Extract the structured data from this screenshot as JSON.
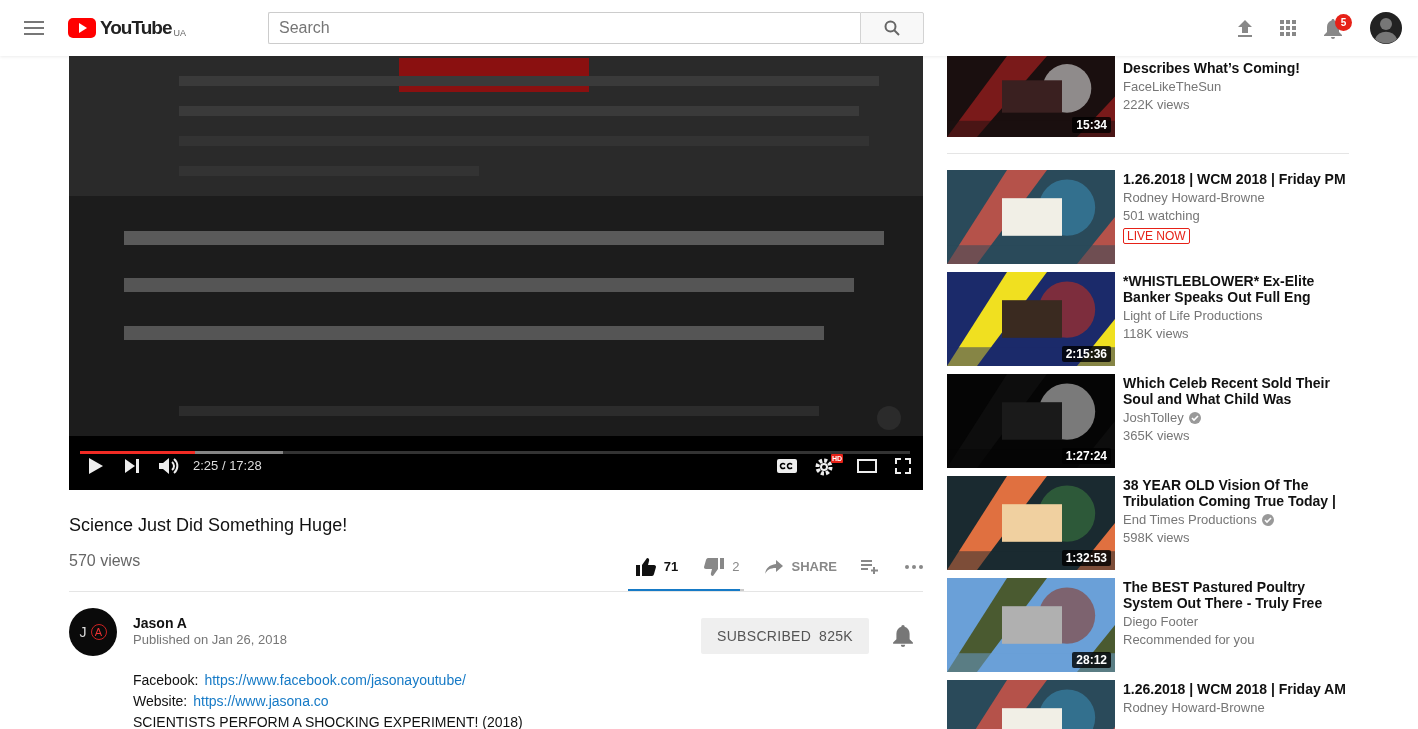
{
  "header": {
    "logo": "YouTube",
    "region": "UA",
    "search": {
      "placeholder": "Search"
    },
    "notifications": "5"
  },
  "player": {
    "progress": {
      "level": 0.139
    },
    "buffered": {
      "level": 0.245
    },
    "time": "2:25 / 17:28",
    "hd_badge": "HD"
  },
  "video": {
    "title": "Science Just Did Something Huge!",
    "views": "570 views",
    "likes": "71",
    "dislikes": "2",
    "share": "SHARE",
    "sentiment": {
      "level": 0.97
    }
  },
  "channel": {
    "avatar_letters": [
      "J",
      "A"
    ],
    "name": "Jason A",
    "published": "Published on Jan 26, 2018",
    "subscribe_label": "SUBSCRIBED",
    "subscribers": "825K",
    "subscribed": true
  },
  "description": [
    {
      "label": "Facebook:",
      "link": "https://www.facebook.com/jasonayoutube/"
    },
    {
      "label": "Website:",
      "link": "https://www.jasona.co"
    },
    {
      "text": "SCIENTISTS PERFORM A SHOCKING EXPERIMENT! (2018)"
    }
  ],
  "sidebar": {
    "items": [
      {
        "title": "Describes What’s Coming!",
        "channel": "FaceLikeTheSun",
        "verified": false,
        "meta": "222K views",
        "duration": "15:34",
        "live": false
      },
      {
        "title": "1.26.2018 | WCM 2018 | Friday PM",
        "channel": "Rodney Howard-Browne",
        "verified": false,
        "meta": "501 watching",
        "live": true,
        "live_label": "LIVE NOW"
      },
      {
        "title": "*WHISTLEBLOWER* Ex-Elite Banker Speaks Out Full Eng",
        "channel": "Light of Life Productions",
        "verified": false,
        "meta": "118K views",
        "duration": "2:15:36",
        "live": false
      },
      {
        "title": "Which Celeb Recent Sold Their Soul and What Child Was",
        "channel": "JoshTolley",
        "verified": true,
        "meta": "365K views",
        "duration": "1:27:24",
        "live": false
      },
      {
        "title": "38 YEAR OLD Vision Of The Tribulation Coming True Today |",
        "channel": "End Times Productions",
        "verified": true,
        "meta": "598K views",
        "duration": "1:32:53",
        "live": false
      },
      {
        "title": "The BEST Pastured Poultry System Out There - Truly Free",
        "channel": "Diego Footer",
        "verified": false,
        "meta": "Recommended for you",
        "duration": "28:12",
        "live": false
      },
      {
        "title": "1.26.2018 | WCM 2018 | Friday AM",
        "channel": "Rodney Howard-Browne",
        "verified": false,
        "live": false
      }
    ]
  }
}
